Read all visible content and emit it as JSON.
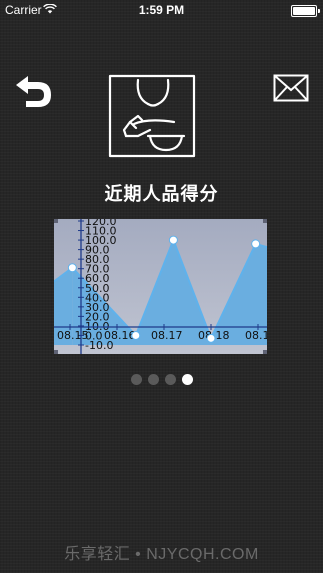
{
  "status_bar": {
    "carrier": "Carrier",
    "time": "1:59 PM"
  },
  "header": {
    "back_icon": "back-arrow-icon",
    "mail_icon": "envelope-icon",
    "hero_icon": "person-praying-icon"
  },
  "title": "近期人品得分",
  "chart_data": {
    "type": "area",
    "x": [
      "08.15",
      "08.16",
      "08.17",
      "08.18",
      "08.19",
      "08.20"
    ],
    "points": [
      {
        "x": 0.05,
        "y": 71
      },
      {
        "x": 1.4,
        "y": 0
      },
      {
        "x": 2.2,
        "y": 100
      },
      {
        "x": 3.0,
        "y": -3
      },
      {
        "x": 3.95,
        "y": 96
      },
      {
        "x": 4.95,
        "y": 82
      },
      {
        "x": 5.8,
        "y": 65
      }
    ],
    "y_ticks": [
      "-10.0",
      "0.0",
      "10.0",
      "20.0",
      "30.0",
      "40.0",
      "50.0",
      "60.0",
      "70.0",
      "80.0",
      "90.0",
      "100.0",
      "110.0",
      "120.0"
    ],
    "ylim": [
      -10,
      120
    ],
    "colors": {
      "fill": "#6aaee0",
      "line": "#5fb2ec",
      "axis": "#1e3a8a",
      "point": "#ffffff"
    }
  },
  "pager": {
    "pages": 4,
    "active_index": 3
  },
  "watermark": "乐享轻汇 • NJYCQH.COM"
}
